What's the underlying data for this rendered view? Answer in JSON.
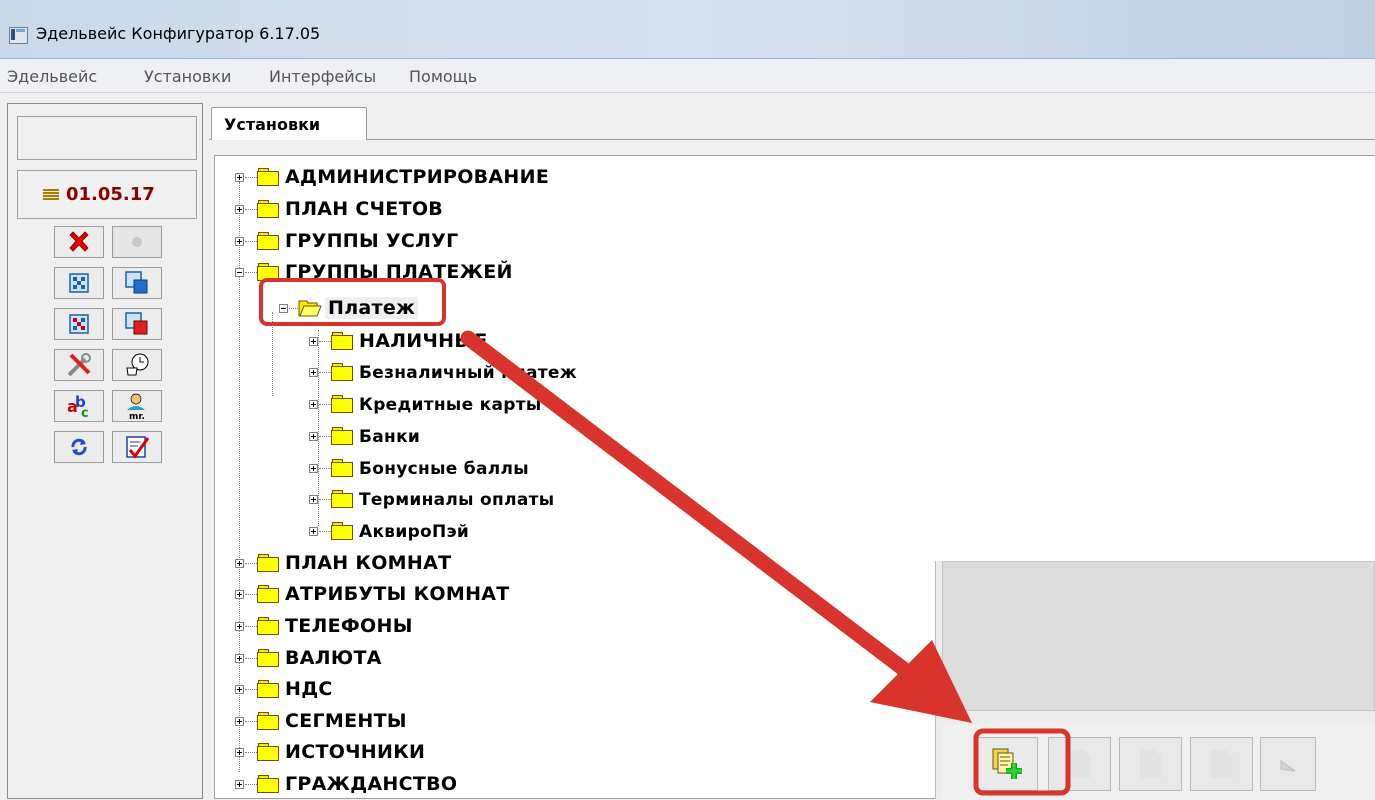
{
  "window": {
    "title": "Эдельвейс Конфигуратор 6.17.05"
  },
  "menu": [
    "Эдельвейс",
    "Установки",
    "Интерфейсы",
    "Помощь"
  ],
  "left_panel": {
    "date": "01.05.17",
    "tools": [
      [
        "close-icon",
        "record-dot-icon"
      ],
      [
        "grid-table-icon",
        "grid-cube-blue-icon"
      ],
      [
        "grid-table-red-icon",
        "grid-cube-red-icon"
      ],
      [
        "tools-wrench-icon",
        "coffee-clock-icon"
      ],
      [
        "abc-spell-icon",
        "user-tax-icon"
      ],
      [
        "refresh-arrows-icon",
        "checklist-icon"
      ]
    ]
  },
  "tabs": {
    "active": "Установки"
  },
  "tree": {
    "top": [
      "АДМИНИСТРИРОВАНИЕ",
      "ПЛАН СЧЕТОВ",
      "ГРУППЫ УСЛУГ",
      "ГРУППЫ ПЛАТЕЖЕЙ"
    ],
    "expanded": "Платеж",
    "children": [
      "НАЛИЧНЫЕ",
      "Безналичный платеж",
      "Кредитные карты",
      "Банки",
      "Бонусные баллы",
      "Терминалы оплаты",
      "АквироПэй"
    ],
    "rest": [
      "ПЛАН КОМНАТ",
      "АТРИБУТЫ КОМНАТ",
      "ТЕЛЕФОНЫ",
      "ВАЛЮТА",
      "НДС",
      "СЕГМЕНТЫ",
      "ИСТОЧНИКИ",
      "ГРАЖДАНСТВО"
    ]
  },
  "bottom_toolbar": [
    "add-record-icon",
    "document-icon",
    "edit-document-icon",
    "delete-document-icon",
    "undo-icon"
  ],
  "colors": {
    "highlight": "#d9342b",
    "date": "#8b0000",
    "folder": "#ffff00"
  }
}
